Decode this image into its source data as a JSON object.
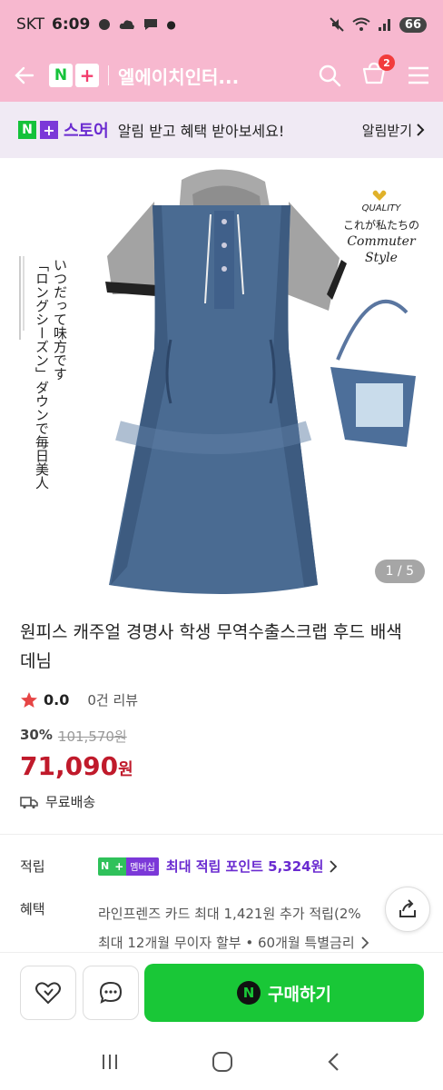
{
  "status_bar": {
    "carrier": "SKT",
    "time": "6:09",
    "battery": "66"
  },
  "header": {
    "logo_n": "N",
    "logo_plus": "+",
    "title": "엘에이치인터...",
    "cart_count": "2"
  },
  "store_banner": {
    "brand_n": "N",
    "brand_plus": "+",
    "brand_name": "스토어",
    "message": "알림 받고 혜택 받아보세요!",
    "cta": "알림받기"
  },
  "image": {
    "counter": "1 / 5",
    "text_vertical_1": "いつだって味方です",
    "text_vertical_2": "「ロングシーズン」ダウンで毎日美人",
    "text_quality": "QUALITY",
    "text_jp": "これが私たちの",
    "text_commuter": "Commuter",
    "text_style": "Style"
  },
  "product": {
    "name": "원피스 캐주얼 경명사 학생 무역수출스크랩 후드 배색 데님",
    "rating": "0.0",
    "reviews": "0건 리뷰",
    "discount": "30%",
    "original_price": "101,570원",
    "price": "71,090",
    "price_unit": "원",
    "shipping": "무료배송"
  },
  "points": {
    "label": "적립",
    "badge_n": "N",
    "badge_plus": "+",
    "badge_text": "멤버십",
    "text": "최대 적립 포인트 5,324원"
  },
  "benefits": {
    "label": "혜택",
    "line1": "라인프렌즈 카드 최대 1,421원 추가 적립(2%",
    "line2": "최대 12개월 무이자 할부 • 60개월 특별금리"
  },
  "buy_bar": {
    "buy_icon": "N",
    "buy_label": "구매하기"
  },
  "colors": {
    "header_pink": "#f7b8cf",
    "buy_green": "#19c737",
    "price_red": "#c01a2b",
    "store_purple": "#6a2bd0"
  }
}
